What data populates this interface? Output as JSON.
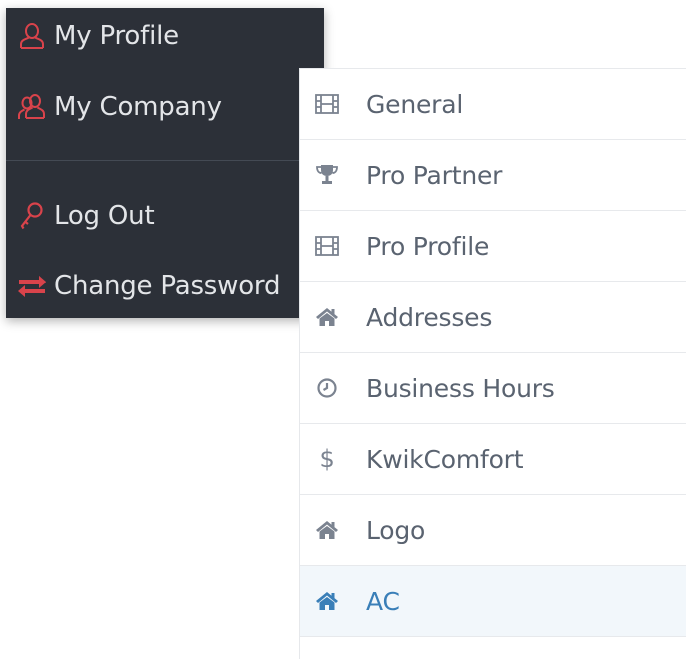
{
  "user_menu": {
    "items": [
      {
        "label": "My Profile",
        "icon": "user-icon"
      },
      {
        "label": "My Company",
        "icon": "users-icon"
      },
      {
        "label": "Log Out",
        "icon": "key-icon"
      },
      {
        "label": "Change Password",
        "icon": "exchange-icon"
      }
    ],
    "colors": {
      "background": "#2c3038",
      "icon": "#d9434b",
      "text": "#e3e5e8"
    }
  },
  "settings_nav": {
    "items": [
      {
        "label": "General",
        "icon": "film-icon"
      },
      {
        "label": "Pro Partner",
        "icon": "trophy-icon"
      },
      {
        "label": "Pro Profile",
        "icon": "film-icon"
      },
      {
        "label": "Addresses",
        "icon": "home-icon"
      },
      {
        "label": "Business Hours",
        "icon": "clock-icon"
      },
      {
        "label": "KwikComfort",
        "icon": "dollar-icon"
      },
      {
        "label": "Logo",
        "icon": "home-icon"
      },
      {
        "label": "AC",
        "icon": "home-icon",
        "active": true
      }
    ],
    "colors": {
      "text": "#5a6370",
      "active_text": "#3a7fb8",
      "active_background": "#f2f7fb"
    }
  }
}
